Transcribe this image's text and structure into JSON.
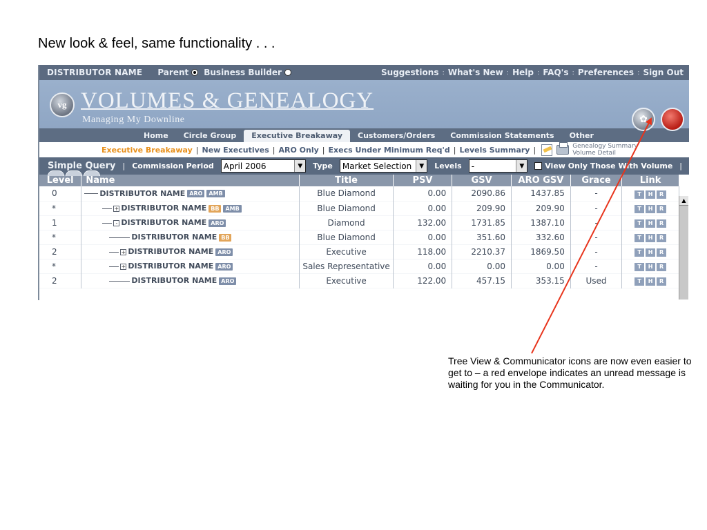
{
  "slide": {
    "title": "New look & feel, same functionality . . .",
    "annotation": "Tree View & Communicator icons are now even easier to get to – a red envelope indicates an unread message is waiting for you in the Communicator."
  },
  "topbar": {
    "distributor": "DISTRIBUTOR NAME",
    "radio_parent": "Parent",
    "radio_business_builder": "Business Builder",
    "radio_selected": "Parent",
    "links": [
      "Suggestions",
      "What's New",
      "Help",
      "FAQ's",
      "Preferences",
      "Sign Out"
    ]
  },
  "header": {
    "logo_mark": "vg",
    "title": "VOLUMES & GENEALOGY",
    "subtitle": "Managing My Downline",
    "icons": [
      "tree-view-icon",
      "communicator-icon"
    ]
  },
  "tabs": {
    "items": [
      "Home",
      "Circle Group",
      "Executive Breakaway",
      "Customers/Orders",
      "Commission Statements",
      "Other"
    ],
    "active": "Executive Breakaway"
  },
  "subnav": {
    "items": [
      "Executive Breakaway",
      "New Executives",
      "ARO Only",
      "Execs Under Minimum Req'd",
      "Levels Summary"
    ],
    "active": "Executive Breakaway",
    "genealogy_summary": "Genealogy Summary",
    "volume_detail": "Volume Detail"
  },
  "query": {
    "simple_query": "Simple Query",
    "commission_period_label": "Commission Period",
    "commission_period_value": "April 2006",
    "type_label": "Type",
    "type_value": "Market Selection",
    "levels_label": "Levels",
    "levels_value": "-",
    "view_only_label": "View Only Those With Volume",
    "view_only_checked": false
  },
  "table": {
    "columns": [
      "Level",
      "Name",
      "Title",
      "PSV",
      "GSV",
      "ARO GSV",
      "Grace",
      "Link"
    ],
    "link_buttons": [
      "T",
      "H",
      "R"
    ],
    "rows": [
      {
        "level": "0",
        "name": "DISTRIBUTOR NAME",
        "indent": 0,
        "expander": "",
        "badges": [
          "ARO",
          "AMB"
        ],
        "title": "Blue Diamond",
        "psv": "0.00",
        "gsv": "2090.86",
        "aro_gsv": "1437.85",
        "grace": "-"
      },
      {
        "level": "*",
        "name": "DISTRIBUTOR NAME",
        "indent": 1,
        "expander": "+",
        "badges": [
          "BB",
          "AMB"
        ],
        "title": "Blue Diamond",
        "psv": "0.00",
        "gsv": "209.90",
        "aro_gsv": "209.90",
        "grace": "-"
      },
      {
        "level": "1",
        "name": "DISTRIBUTOR NAME",
        "indent": 1,
        "expander": "-",
        "badges": [
          "ARO"
        ],
        "title": "Diamond",
        "psv": "132.00",
        "gsv": "1731.85",
        "aro_gsv": "1387.10",
        "grace": "-"
      },
      {
        "level": "*",
        "name": "DISTRIBUTOR NAME",
        "indent": 2,
        "expander": "",
        "badges": [
          "BB"
        ],
        "title": "Blue Diamond",
        "psv": "0.00",
        "gsv": "351.60",
        "aro_gsv": "332.60",
        "grace": "-"
      },
      {
        "level": "2",
        "name": "DISTRIBUTOR NAME",
        "indent": 2,
        "expander": "+",
        "badges": [
          "ARO"
        ],
        "title": "Executive",
        "psv": "118.00",
        "gsv": "2210.37",
        "aro_gsv": "1869.50",
        "grace": "-"
      },
      {
        "level": "*",
        "name": "DISTRIBUTOR NAME",
        "indent": 2,
        "expander": "+",
        "badges": [
          "ARO"
        ],
        "title": "Sales Representative",
        "psv": "0.00",
        "gsv": "0.00",
        "aro_gsv": "0.00",
        "grace": "-"
      },
      {
        "level": "2",
        "name": "DISTRIBUTOR NAME",
        "indent": 2,
        "expander": "",
        "badges": [
          "ARO"
        ],
        "title": "Executive",
        "psv": "122.00",
        "gsv": "457.15",
        "aro_gsv": "353.15",
        "grace": "Used"
      }
    ]
  },
  "colors": {
    "topbar": "#5b6a80",
    "header": "#9ab0cc",
    "active_subnav": "#e8901b",
    "badge_bb": "#e2a55a",
    "badge_aro": "#7e8ea9",
    "arrow": "#e8341c",
    "communicator": "#b81c14"
  }
}
